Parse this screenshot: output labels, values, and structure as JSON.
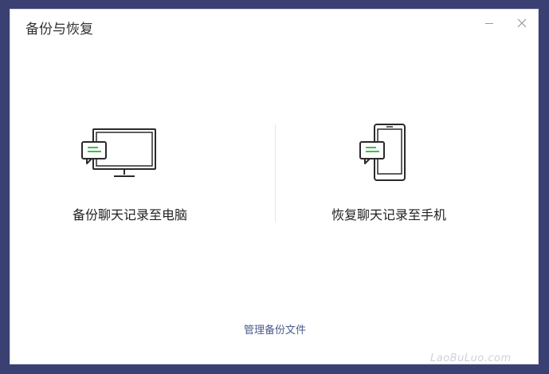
{
  "window": {
    "title": "备份与恢复",
    "minimize_glyph": "minimize",
    "close_glyph": "close"
  },
  "options": {
    "backup_label": "备份聊天记录至电脑",
    "restore_label": "恢复聊天记录至手机"
  },
  "footer": {
    "manage_label": "管理备份文件"
  },
  "watermark": {
    "text": "LaoBuLuo.com"
  },
  "colors": {
    "background": "#3a4172",
    "accent_green": "#3cc14a",
    "link": "#4a5a8a"
  },
  "icons": {
    "backup": "monitor-chat-icon",
    "restore": "phone-chat-icon"
  }
}
